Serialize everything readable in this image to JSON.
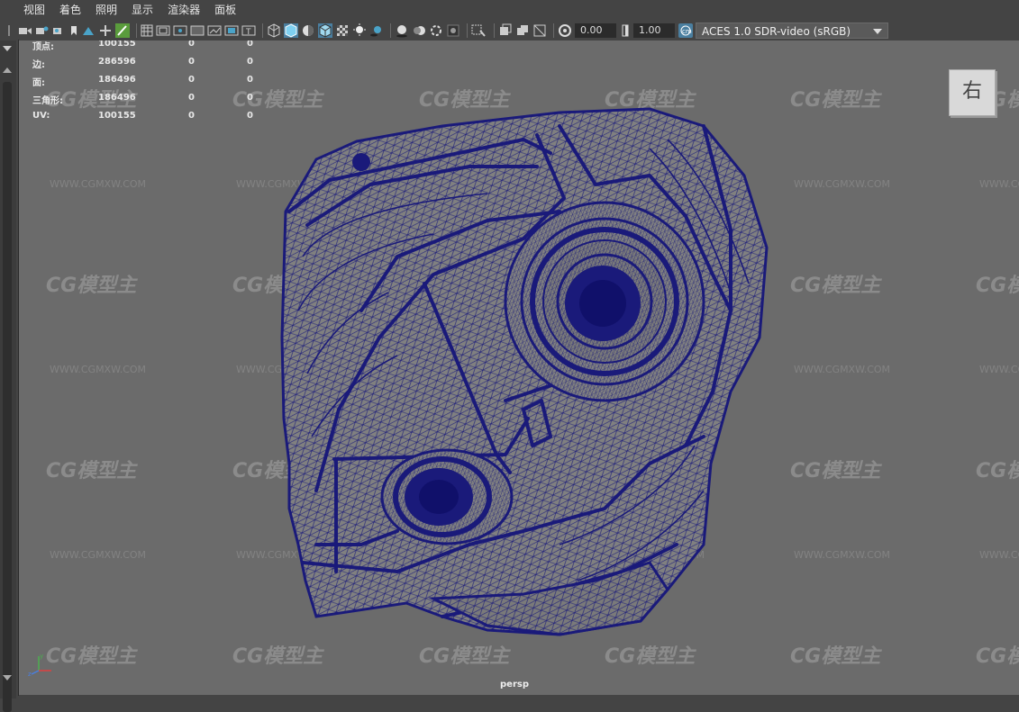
{
  "menu": [
    "视图",
    "着色",
    "照明",
    "显示",
    "渲染器",
    "面板"
  ],
  "toolbar": {
    "gamma_value": "0.00",
    "exposure_value": "1.00",
    "color_management": "ACES 1.0 SDR-video (sRGB)",
    "icons": [
      "camera-select-icon",
      "camera-lock-icon",
      "camera-attr-icon",
      "bookmark-icon",
      "image-plane-icon",
      "move-2d-icon",
      "grease-pencil-icon",
      "grid-icon",
      "film-gate-icon",
      "resolution-gate-icon",
      "gate-mask-icon",
      "field-chart-icon",
      "safe-action-icon",
      "safe-title-icon",
      "wireframe-icon",
      "smooth-shade-icon",
      "default-material-icon",
      "wireframe-on-shaded-icon",
      "textured-icon",
      "lighting-icon",
      "shadows-icon",
      "screen-ambient-occlusion-icon",
      "motion-blur-icon",
      "anti-aliasing-icon",
      "depth-of-field-icon",
      "isolate-select-icon",
      "xray-icon",
      "xray-active-icon",
      "xray-joints-icon",
      "backface-icon",
      "exposure-icon",
      "gamma-icon",
      "color-management-icon"
    ]
  },
  "stats": [
    {
      "label": "顶点:",
      "v1": "100155",
      "v2": "0",
      "v3": "0"
    },
    {
      "label": "边:",
      "v1": "286596",
      "v2": "0",
      "v3": "0"
    },
    {
      "label": "面:",
      "v1": "186496",
      "v2": "0",
      "v3": "0"
    },
    {
      "label": "三角形:",
      "v1": "186496",
      "v2": "0",
      "v3": "0"
    },
    {
      "label": "UV:",
      "v1": "100155",
      "v2": "0",
      "v3": "0"
    }
  ],
  "viewcube_label": "右",
  "camera_label": "persp",
  "watermark": {
    "brand": "CG模型主",
    "url": "WWW.CGMXW.COM"
  },
  "colors": {
    "viewport_bg": "#6b6b6b",
    "wire": "#1a1a7a",
    "accent": "#4aa3c8"
  }
}
